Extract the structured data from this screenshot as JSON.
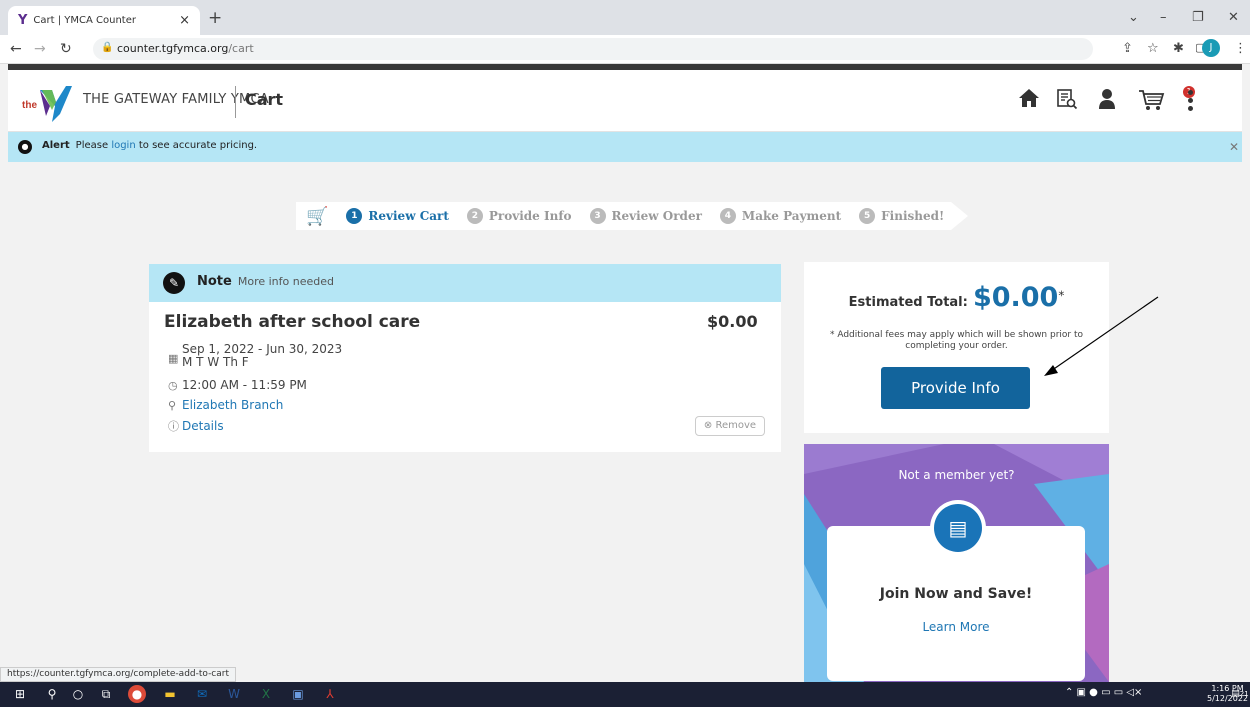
{
  "browser": {
    "tab_title": "Cart | YMCA Counter",
    "url_domain": "counter.tgfymca.org",
    "url_path": "/cart",
    "avatar_initial": "J"
  },
  "header": {
    "brand_prefix": "the",
    "brand_name": "THE GATEWAY FAMILY YMCA",
    "page_title": "Cart",
    "cart_count": "1"
  },
  "alert": {
    "label": "Alert",
    "text_before": "Please ",
    "link": "login",
    "text_after": " to see accurate pricing."
  },
  "steps": [
    {
      "num": "1",
      "label": "Review Cart",
      "active": true
    },
    {
      "num": "2",
      "label": "Provide Info"
    },
    {
      "num": "3",
      "label": "Review Order"
    },
    {
      "num": "4",
      "label": "Make Payment"
    },
    {
      "num": "5",
      "label": "Finished!"
    }
  ],
  "item": {
    "note_label": "Note",
    "note_text": "More info needed",
    "name": "Elizabeth after school care",
    "price": "$0.00",
    "dates": "Sep 1, 2022 - Jun 30, 2023",
    "days": "M T W Th F",
    "time": "12:00 AM - 11:59 PM",
    "branch": "Elizabeth Branch",
    "details": "Details",
    "remove": "Remove"
  },
  "summary": {
    "label": "Estimated Total:",
    "amount": "$0.00",
    "asterisk": "*",
    "fees_note": "* Additional fees may apply which will be shown prior to completing your order.",
    "button": "Provide Info"
  },
  "promo": {
    "title": "Not a member yet?",
    "headline": "Join Now and Save!",
    "link": "Learn More"
  },
  "status_url": "https://counter.tgfymca.org/complete-add-to-cart",
  "taskbar": {
    "time": "1:16 PM",
    "date": "5/12/2022",
    "notif_count": "21"
  },
  "colors": {
    "accent": "#12649c",
    "alert_bg": "#b5e6f5",
    "promo_purple": "#8b67c2"
  }
}
